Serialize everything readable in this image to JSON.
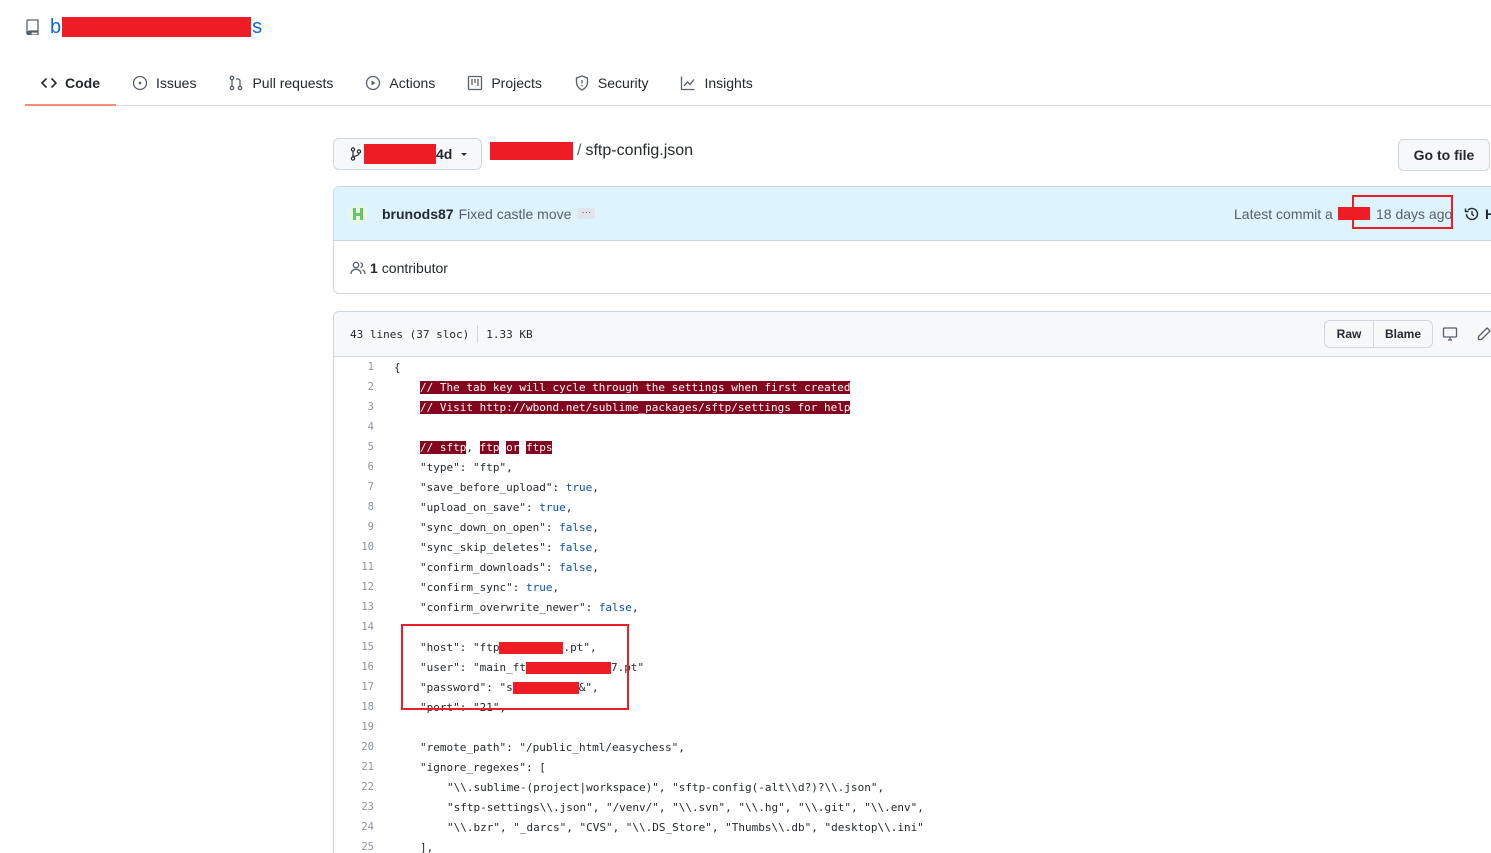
{
  "repo": {
    "name_start": "b",
    "name_end": "s"
  },
  "nav": {
    "items": [
      {
        "label": "Code",
        "icon": "code-icon",
        "active": true
      },
      {
        "label": "Issues",
        "icon": "issue-icon"
      },
      {
        "label": "Pull requests",
        "icon": "pull-request-icon"
      },
      {
        "label": "Actions",
        "icon": "play-icon"
      },
      {
        "label": "Projects",
        "icon": "project-icon"
      },
      {
        "label": "Security",
        "icon": "shield-icon"
      },
      {
        "label": "Insights",
        "icon": "graph-icon"
      }
    ]
  },
  "branch": {
    "suffix": "4d"
  },
  "breadcrumb": {
    "separator": "/",
    "file": "sftp-config.json"
  },
  "goto_file": "Go to file",
  "commit": {
    "author": "brunods87",
    "message": "Fixed castle move",
    "ellipsis": "…",
    "latest_label": "Latest commit a",
    "ago": "18 days ago",
    "history_partial": "H"
  },
  "contributors": {
    "count": "1",
    "label": "contributor"
  },
  "file": {
    "lines_info": "43 lines (37 sloc)",
    "size": "1.33 KB",
    "raw_label": "Raw",
    "blame_label": "Blame"
  },
  "colors": {
    "accent": "#fd8c73",
    "redaction": "#ee1c25",
    "comment_bg": "#82071e",
    "link": "#0969da"
  },
  "code": {
    "l1": "{",
    "l2": "// The tab key will cycle through the settings when first created",
    "l3": "// Visit http://wbond.net/sublime_packages/sftp/settings for help",
    "l4": "",
    "l5a": "// sftp",
    "l5b": ", ",
    "l5c": "ftp",
    "l5d": " ",
    "l5e": "or",
    "l5f": " ",
    "l5g": "ftps",
    "l6": "\"type\": \"ftp\",",
    "l7a": "\"save_before_upload\": ",
    "l7b": "true",
    "l7c": ",",
    "l8a": "\"upload_on_save\": ",
    "l8b": "true",
    "l8c": ",",
    "l9a": "\"sync_down_on_open\": ",
    "l9b": "false",
    "l9c": ",",
    "l10a": "\"sync_skip_deletes\": ",
    "l10b": "false",
    "l10c": ",",
    "l11a": "\"confirm_downloads\": ",
    "l11b": "false",
    "l11c": ",",
    "l12a": "\"confirm_sync\": ",
    "l12b": "true",
    "l12c": ",",
    "l13a": "\"confirm_overwrite_newer\": ",
    "l13b": "false",
    "l13c": ",",
    "l14": "",
    "l15a": "\"host\": \"ftp",
    "l15b": ".pt\",",
    "l16a": "\"user\": \"main_ft",
    "l16b": "7.pt\"",
    "l17a": "\"password\": \"s",
    "l17b": "&\",",
    "l18": "\"port\": \"21\",",
    "l19": "",
    "l20": "\"remote_path\": \"/public_html/easychess\",",
    "l21": "\"ignore_regexes\": [",
    "l22": "\"\\\\.sublime-(project|workspace)\", \"sftp-config(-alt\\\\d?)?\\\\.json\",",
    "l23": "\"sftp-settings\\\\.json\", \"/venv/\", \"\\\\.svn\", \"\\\\.hg\", \"\\\\.git\", \"\\\\.env\",",
    "l24": "\"\\\\.bzr\", \"_darcs\", \"CVS\", \"\\\\.DS_Store\", \"Thumbs\\\\.db\", \"desktop\\\\.ini\"",
    "l25": "],"
  }
}
